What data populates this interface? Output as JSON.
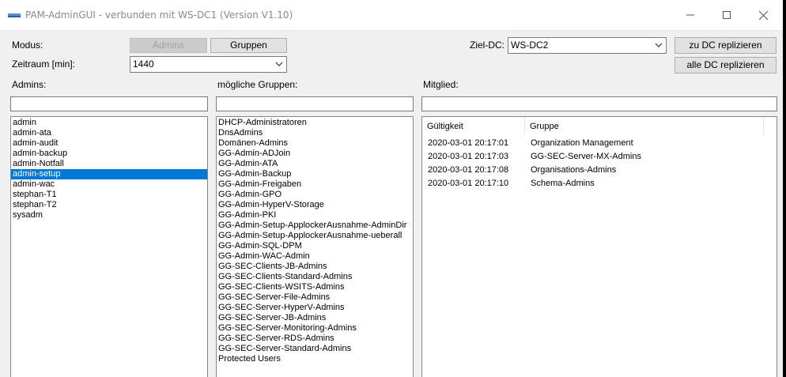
{
  "window": {
    "title": "PAM-AdminGUI - verbunden mit WS-DC1 (Version V1.10)"
  },
  "labels": {
    "modus": "Modus:",
    "zeitraum": "Zeitraum [min]:",
    "ziel_dc": "Ziel-DC:",
    "admins": "Admins:",
    "gruppen": "mögliche Gruppen:",
    "mitglied": "Mitglied:"
  },
  "buttons": {
    "admins": "Admins",
    "gruppen": "Gruppen",
    "zu_dc": "zu DC replizieren",
    "alle_dc": "alle DC replizieren"
  },
  "combos": {
    "zeitraum": "1440",
    "ziel_dc": "WS-DC2"
  },
  "admins": [
    "admin",
    "admin-ata",
    "admin-audit",
    "admin-backup",
    "admin-Notfall",
    "admin-setup",
    "admin-wac",
    "stephan-T1",
    "stephan-T2",
    "sysadm"
  ],
  "admins_selected": "admin-setup",
  "groups": [
    "DHCP-Administratoren",
    "DnsAdmins",
    "Domänen-Admins",
    "GG-Admin-ADJoin",
    "GG-Admin-ATA",
    "GG-Admin-Backup",
    "GG-Admin-Freigaben",
    "GG-Admin-GPO",
    "GG-Admin-HyperV-Storage",
    "GG-Admin-PKI",
    "GG-Admin-Setup-ApplockerAusnahme-AdminDir",
    "GG-Admin-Setup-ApplockerAusnahme-ueberall",
    "GG-Admin-SQL-DPM",
    "GG-Admin-WAC-Admin",
    "GG-SEC-Clients-JB-Admins",
    "GG-SEC-Clients-Standard-Admins",
    "GG-SEC-Clients-WSITS-Admins",
    "GG-SEC-Server-File-Admins",
    "GG-SEC-Server-HyperV-Admins",
    "GG-SEC-Server-JB-Admins",
    "GG-SEC-Server-Monitoring-Admins",
    "GG-SEC-Server-RDS-Admins",
    "GG-SEC-Server-Standard-Admins",
    "Protected Users"
  ],
  "membership": {
    "columns": [
      "Gültigkeit",
      "Gruppe"
    ],
    "rows": [
      [
        "2020-03-01 20:17:01",
        "Organization Management"
      ],
      [
        "2020-03-01 20:17:03",
        "GG-SEC-Server-MX-Admins"
      ],
      [
        "2020-03-01 20:17:08",
        "Organisations-Admins"
      ],
      [
        "2020-03-01 20:17:10",
        "Schema-Admins"
      ]
    ]
  },
  "colors": {
    "selection": "#0078d7",
    "window_bg": "#f0f0f0"
  }
}
